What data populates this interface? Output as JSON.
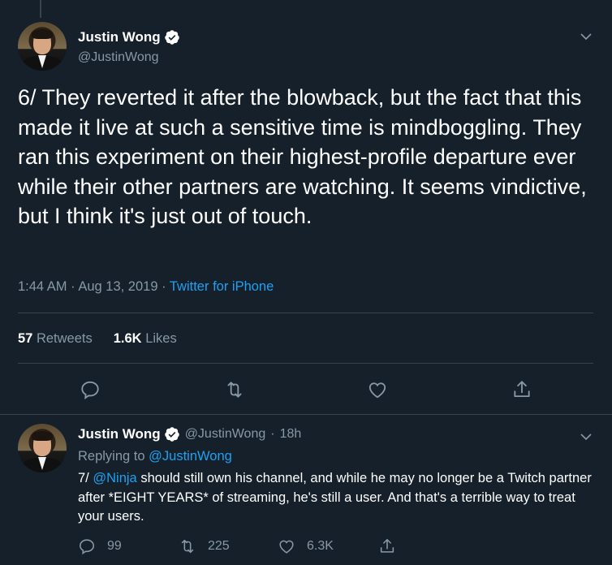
{
  "main_tweet": {
    "author": {
      "display_name": "Justin Wong",
      "handle": "@JustinWong",
      "verified": true
    },
    "text": "6/ They reverted it after the blowback, but the fact that this made it live at such a sensitive time is mindboggling. They ran this experiment on their highest-profile departure ever while their other partners are watching. It seems vindictive, but I think it's just out of touch.",
    "time": "1:44 AM",
    "separator": "·",
    "date": "Aug 13, 2019",
    "source": "Twitter for iPhone",
    "retweets_count": "57",
    "retweets_label": "Retweets",
    "likes_count": "1.6K",
    "likes_label": "Likes",
    "actions": [
      "reply-icon",
      "retweet-icon",
      "like-icon",
      "share-icon"
    ]
  },
  "reply_tweet": {
    "author": {
      "display_name": "Justin Wong",
      "handle": "@JustinWong",
      "verified": true
    },
    "age": "18h",
    "dot": "·",
    "replying_prefix": "Replying to",
    "replying_to": "@JustinWong",
    "text_prefix": "7/",
    "mention": "@Ninja",
    "text_body": "should still own his channel, and while he may no longer be a Twitch partner after *EIGHT YEARS* of streaming, he's still a user. And that's a terrible way to treat your users.",
    "reply_count": "99",
    "retweet_count": "225",
    "like_count": "6.3K"
  },
  "colors": {
    "background": "#15202b",
    "border": "#38444d",
    "secondary_text": "#8899a6",
    "accent": "#1da1f2"
  }
}
